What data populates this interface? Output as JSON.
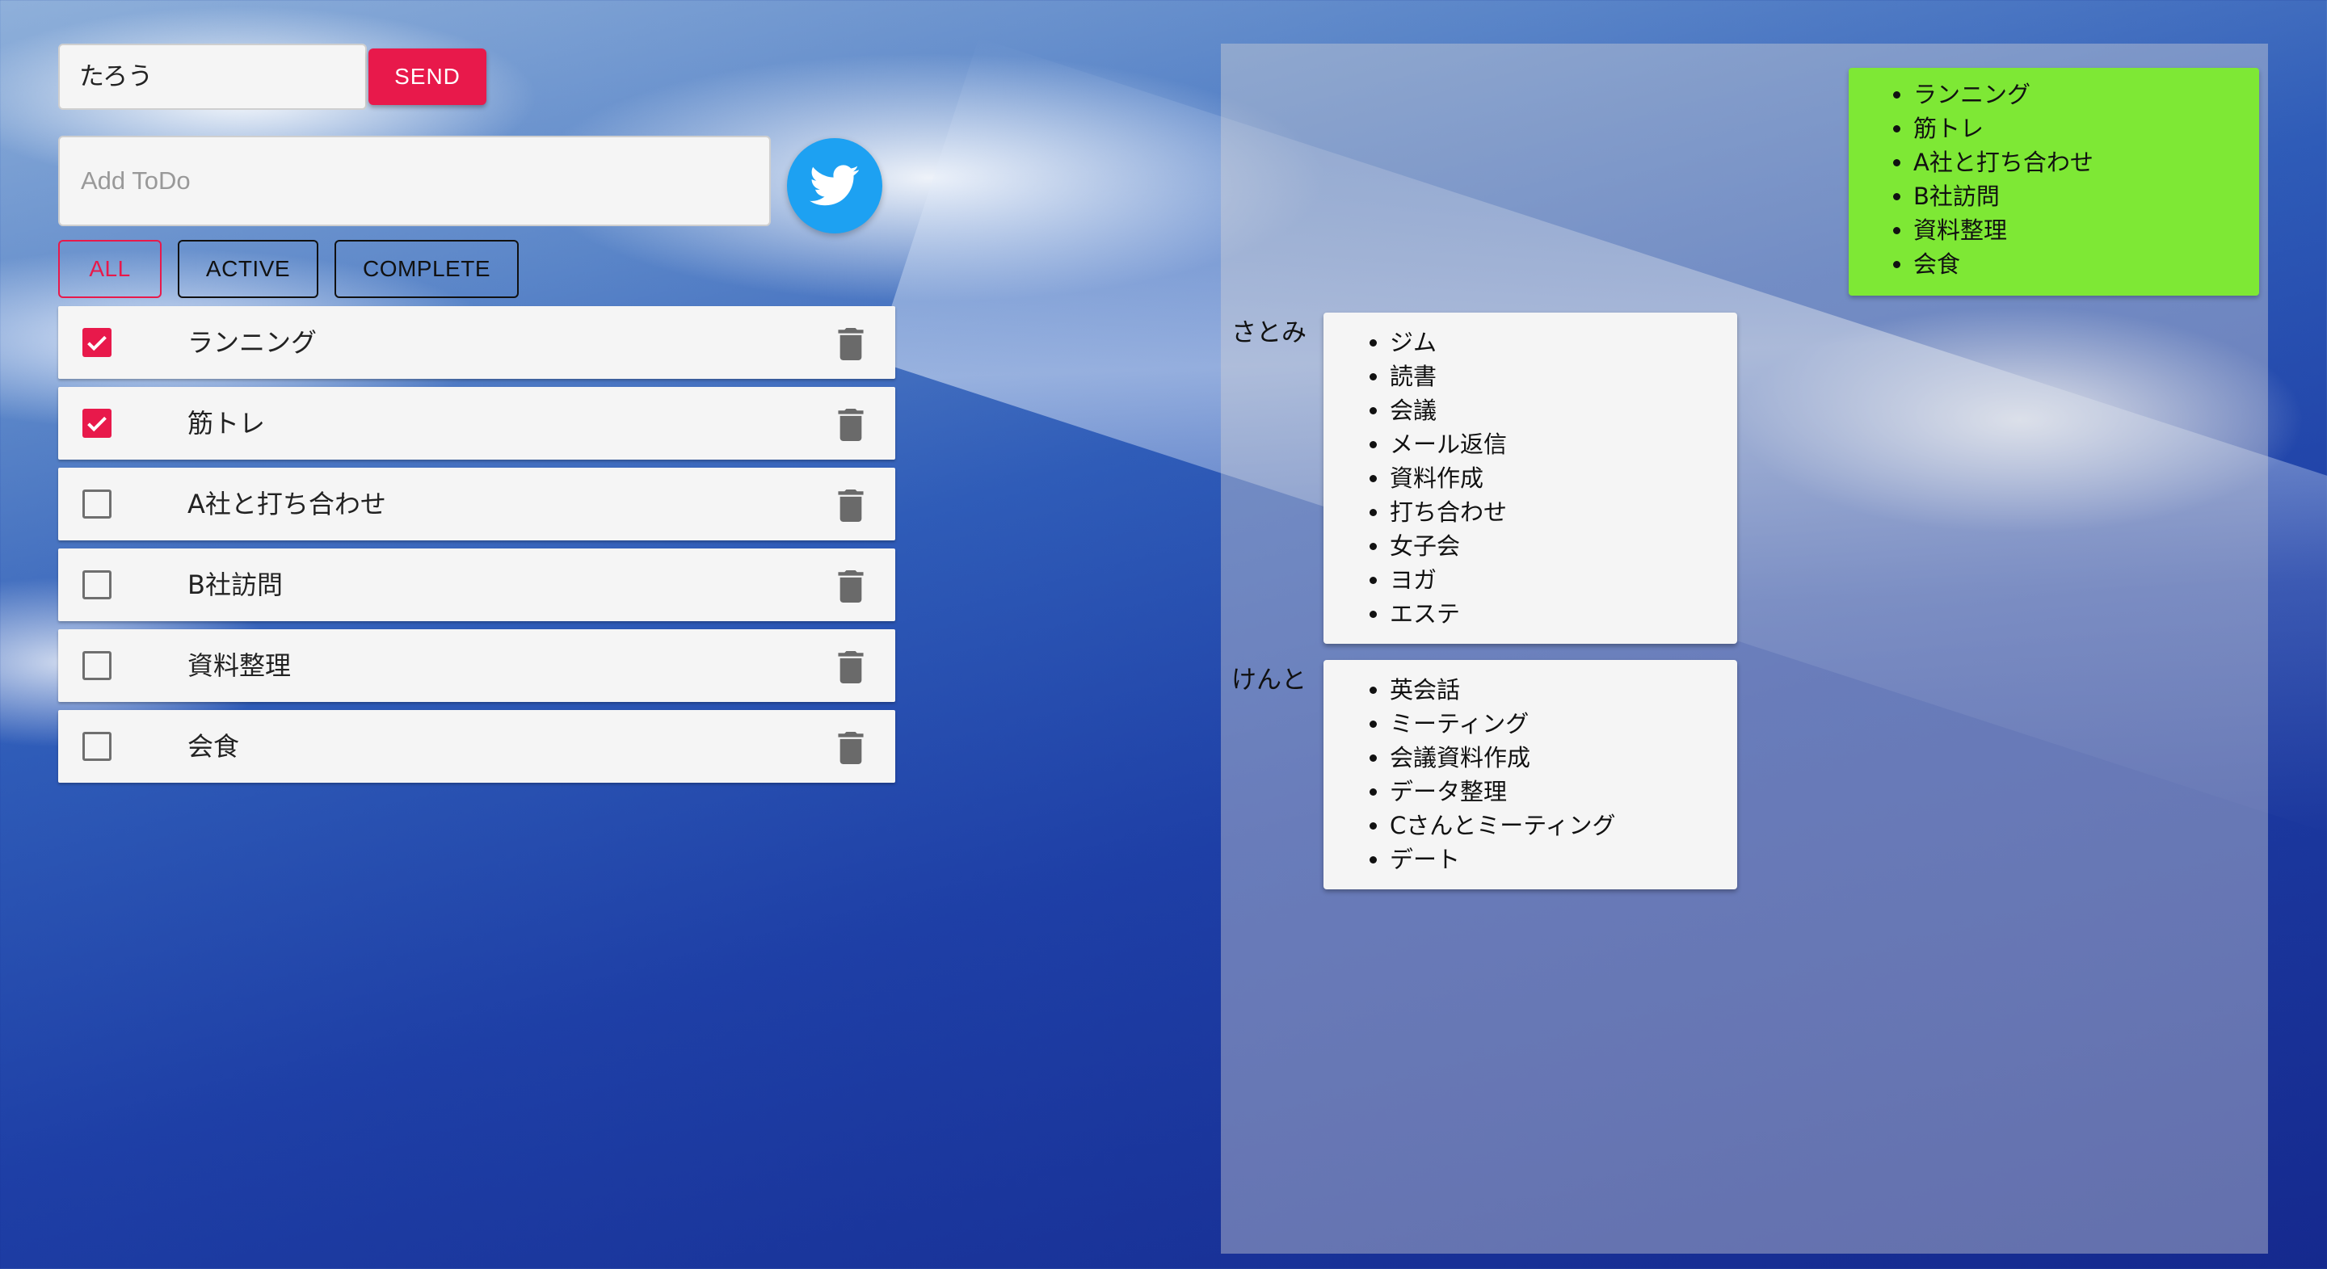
{
  "user": {
    "name": "たろう"
  },
  "send_label": "SEND",
  "todo_input": {
    "placeholder": "Add ToDo"
  },
  "filters": {
    "all": "ALL",
    "active": "ACTIVE",
    "complete": "COMPLETE"
  },
  "todos": [
    {
      "text": "ランニング",
      "checked": true
    },
    {
      "text": "筋トレ",
      "checked": true
    },
    {
      "text": "A社と打ち合わせ",
      "checked": false
    },
    {
      "text": "B社訪問",
      "checked": false
    },
    {
      "text": "資料整理",
      "checked": false
    },
    {
      "text": "会食",
      "checked": false
    }
  ],
  "own_list": {
    "items": [
      "ランニング",
      "筋トレ",
      "A社と打ち合わせ",
      "B社訪問",
      "資料整理",
      "会食"
    ]
  },
  "others": [
    {
      "name": "さとみ",
      "items": [
        "ジム",
        "読書",
        "会議",
        "メール返信",
        "資料作成",
        "打ち合わせ",
        "女子会",
        "ヨガ",
        "エステ"
      ]
    },
    {
      "name": "けんと",
      "items": [
        "英会話",
        "ミーティング",
        "会議資料作成",
        "データ整理",
        "Cさんとミーティング",
        "デート"
      ]
    }
  ],
  "colors": {
    "accent": "#e8194b",
    "own_card": "#7ee835",
    "twitter": "#1da1f2"
  },
  "icons": {
    "twitter": "twitter-icon",
    "trash": "trash-icon",
    "check": "check-icon"
  }
}
